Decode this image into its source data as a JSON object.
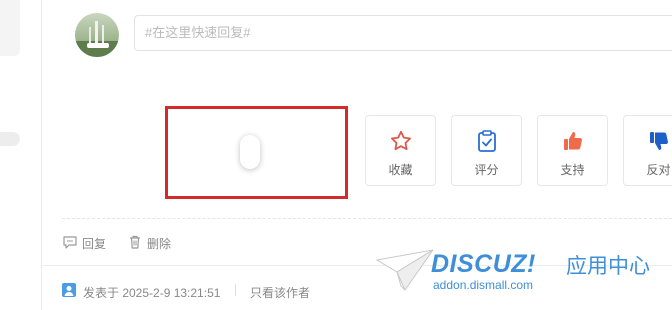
{
  "reply_box": {
    "placeholder": "#在这里快速回复#"
  },
  "actions": [
    {
      "label": "收藏",
      "icon": "star-icon",
      "color": "#e0584d"
    },
    {
      "label": "评分",
      "icon": "clipboard-check-icon",
      "color": "#2a6fd3"
    },
    {
      "label": "支持",
      "icon": "thumbs-up-icon",
      "color": "#ef6b4a"
    },
    {
      "label": "反对",
      "icon": "thumbs-down-icon",
      "color": "#1f5fc9"
    }
  ],
  "post_ops": {
    "reply_label": "回复",
    "delete_label": "删除"
  },
  "post_meta": {
    "posted_at": "发表于 2025-2-9 13:21:51",
    "only_author_label": "只看该作者"
  },
  "watermark": {
    "brand": "DISCUZ!",
    "cn": "应用中心",
    "url": "addon.dismall.com"
  },
  "colors": {
    "highlight": "#d22b2b",
    "accent": "#3e8fd8"
  }
}
